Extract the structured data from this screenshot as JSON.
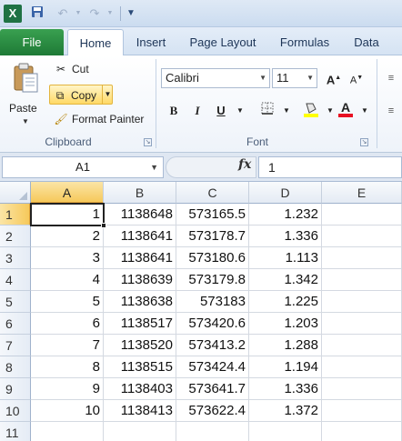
{
  "qat": {
    "app_icon": "excel-icon",
    "save_icon": "save-icon",
    "undo_icon": "undo-icon",
    "redo_icon": "redo-icon",
    "customize_icon": "customize-qat-icon"
  },
  "app_logo_text": "X",
  "tabs": [
    {
      "label": "File"
    },
    {
      "label": "Home"
    },
    {
      "label": "Insert"
    },
    {
      "label": "Page Layout"
    },
    {
      "label": "Formulas"
    },
    {
      "label": "Data"
    }
  ],
  "clipboard": {
    "paste": "Paste",
    "cut": "Cut",
    "copy": "Copy",
    "format_painter": "Format Painter",
    "group_label": "Clipboard"
  },
  "font": {
    "name": "Calibri",
    "size": "11",
    "bold": "B",
    "italic": "I",
    "underline": "U",
    "grow": "A",
    "shrink": "A",
    "group_label": "Font",
    "highlight_color": "#ffff00",
    "font_color": "#e81123"
  },
  "formula_bar": {
    "name_box": "A1",
    "fx": "fx",
    "value": "1"
  },
  "columns": [
    "A",
    "B",
    "C",
    "D",
    "E"
  ],
  "rows": [
    {
      "n": "1",
      "A": "1",
      "B": "1138648",
      "C": "573165.5",
      "D": "1.232"
    },
    {
      "n": "2",
      "A": "2",
      "B": "1138641",
      "C": "573178.7",
      "D": "1.336"
    },
    {
      "n": "3",
      "A": "3",
      "B": "1138641",
      "C": "573180.6",
      "D": "1.113"
    },
    {
      "n": "4",
      "A": "4",
      "B": "1138639",
      "C": "573179.8",
      "D": "1.342"
    },
    {
      "n": "5",
      "A": "5",
      "B": "1138638",
      "C": "573183",
      "D": "1.225"
    },
    {
      "n": "6",
      "A": "6",
      "B": "1138517",
      "C": "573420.6",
      "D": "1.203"
    },
    {
      "n": "7",
      "A": "7",
      "B": "1138520",
      "C": "573413.2",
      "D": "1.288"
    },
    {
      "n": "8",
      "A": "8",
      "B": "1138515",
      "C": "573424.4",
      "D": "1.194"
    },
    {
      "n": "9",
      "A": "9",
      "B": "1138403",
      "C": "573641.7",
      "D": "1.336"
    },
    {
      "n": "10",
      "A": "10",
      "B": "1138413",
      "C": "573622.4",
      "D": "1.372"
    },
    {
      "n": "11",
      "A": "",
      "B": "",
      "C": "",
      "D": ""
    }
  ]
}
